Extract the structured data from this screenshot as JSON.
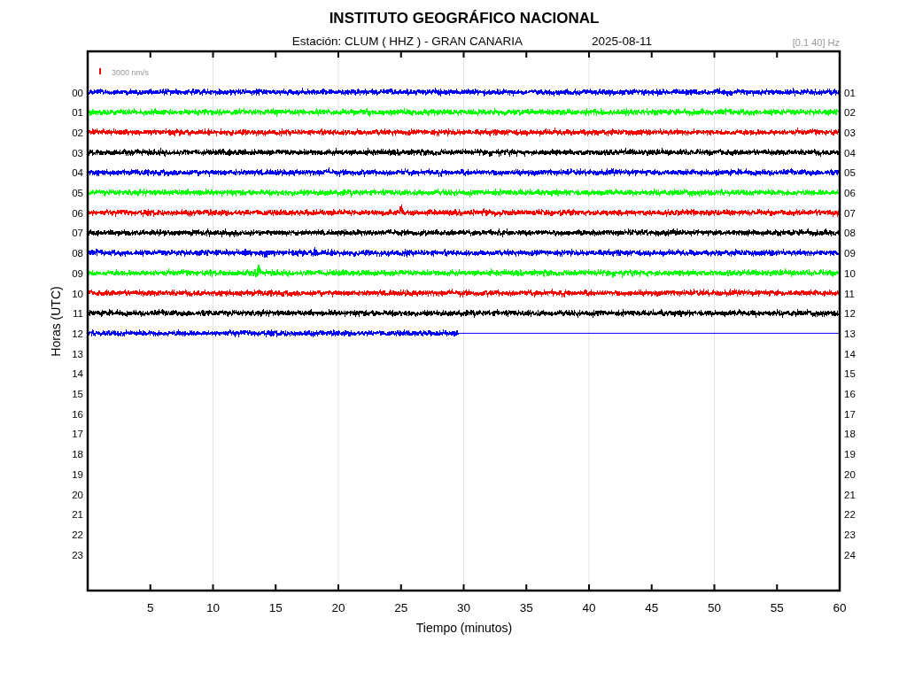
{
  "title": "INSTITUTO GEOGRÁFICO NACIONAL",
  "station": "Estación:  CLUM ( HHZ ) - GRAN CANARIA",
  "date": "2025-08-11",
  "filter": "[0.1 40] Hz",
  "scale": {
    "label": "3000 nm/s",
    "color": "#ff0000"
  },
  "y_label": "Horas (UTC)",
  "x_label": "Tiempo (minutos)",
  "x_ticks": [
    "5",
    "10",
    "15",
    "20",
    "25",
    "30",
    "35",
    "40",
    "45",
    "50",
    "55",
    "60"
  ],
  "left_labels": [
    "00",
    "01",
    "02",
    "03",
    "04",
    "05",
    "06",
    "07",
    "08",
    "09",
    "10",
    "11",
    "12",
    "13",
    "14",
    "15",
    "16",
    "17",
    "18",
    "19",
    "20",
    "21",
    "22",
    "23"
  ],
  "right_labels": [
    "01",
    "02",
    "03",
    "04",
    "05",
    "06",
    "07",
    "08",
    "09",
    "10",
    "11",
    "12",
    "13",
    "14",
    "15",
    "16",
    "17",
    "18",
    "19",
    "20",
    "21",
    "22",
    "23",
    "24"
  ],
  "traces": [
    {
      "color": "#0000ff",
      "level": 1
    },
    {
      "color": "#00ff00",
      "level": 1
    },
    {
      "color": "#ff0000",
      "level": 1
    },
    {
      "color": "#000000",
      "level": 1
    },
    {
      "color": "#0000ff",
      "level": 1
    },
    {
      "color": "#00ff00",
      "level": 1
    },
    {
      "color": "#ff0000",
      "level": 1
    },
    {
      "color": "#000000",
      "level": 1
    },
    {
      "color": "#0000ff",
      "level": 1
    },
    {
      "color": "#00ff00",
      "level": 1
    },
    {
      "color": "#ff0000",
      "level": 1
    },
    {
      "color": "#000000",
      "level": 1
    },
    {
      "color": "#0000ff",
      "level": 0.493
    }
  ]
}
